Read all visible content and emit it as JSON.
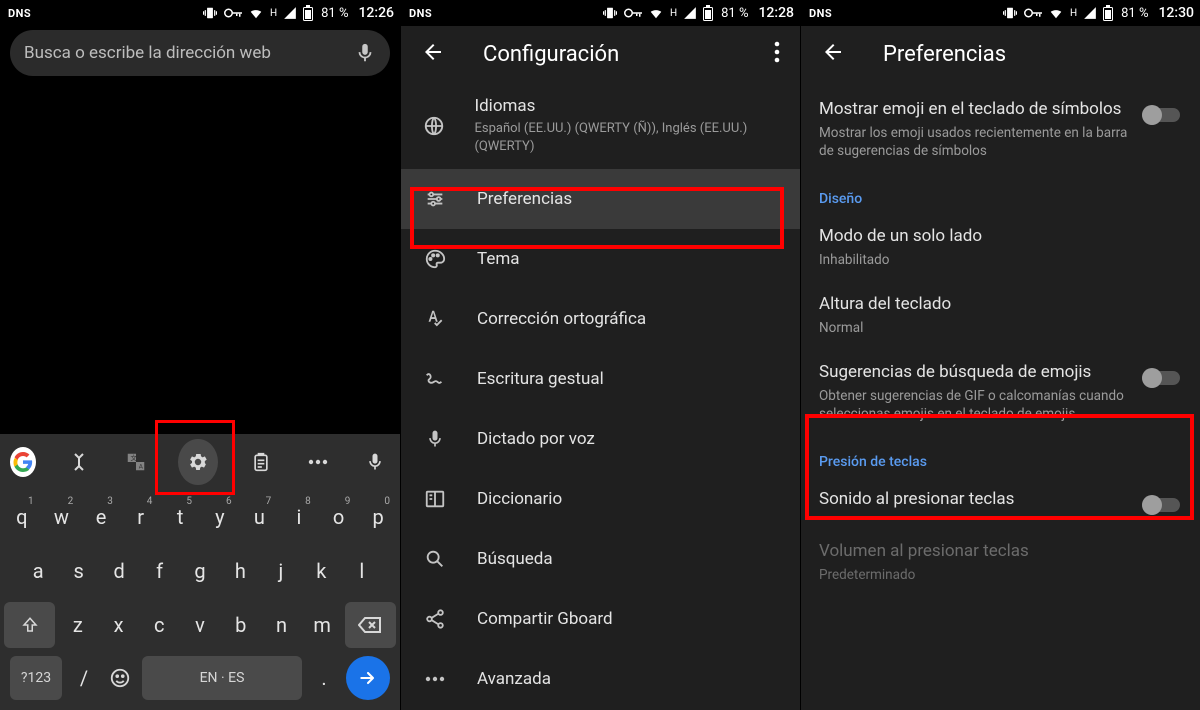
{
  "status": {
    "dns": "DNS",
    "h": "H",
    "batt": "81 %",
    "clocks": [
      "12:26",
      "12:28",
      "12:30"
    ]
  },
  "panel1": {
    "search_placeholder": "Busca o escribe la dirección web",
    "keyboard": {
      "row1": [
        "q",
        "w",
        "e",
        "r",
        "t",
        "y",
        "u",
        "i",
        "o",
        "p"
      ],
      "row1_sup": [
        "1",
        "2",
        "3",
        "4",
        "5",
        "6",
        "7",
        "8",
        "9",
        "0"
      ],
      "row2": [
        "a",
        "s",
        "d",
        "f",
        "g",
        "h",
        "j",
        "k",
        "l"
      ],
      "row3_mid": [
        "z",
        "x",
        "c",
        "v",
        "b",
        "n",
        "m"
      ],
      "sym_key": "?123",
      "slash_key": "/",
      "space_label": "EN · ES",
      "dot_key": "."
    }
  },
  "panel2": {
    "title": "Configuración",
    "items": [
      {
        "icon": "globe",
        "label": "Idiomas",
        "sub": "Español (EE.UU.) (QWERTY (Ñ)), Inglés (EE.UU.) (QWERTY)"
      },
      {
        "icon": "sliders",
        "label": "Preferencias",
        "highlight": true
      },
      {
        "icon": "palette",
        "label": "Tema"
      },
      {
        "icon": "spellcheck",
        "label": "Corrección ortográfica"
      },
      {
        "icon": "gesture",
        "label": "Escritura gestual"
      },
      {
        "icon": "mic",
        "label": "Dictado por voz"
      },
      {
        "icon": "book",
        "label": "Diccionario"
      },
      {
        "icon": "search",
        "label": "Búsqueda"
      },
      {
        "icon": "share",
        "label": "Compartir Gboard"
      },
      {
        "icon": "dots",
        "label": "Avanzada"
      }
    ]
  },
  "panel3": {
    "title": "Preferencias",
    "items": [
      {
        "type": "pref",
        "ttl": "Mostrar emoji en el teclado de símbolos",
        "sub": "Mostrar los emoji usados recientemente en la barra de sugerencias de símbolos",
        "toggle": false
      },
      {
        "type": "head",
        "ttl": "Diseño"
      },
      {
        "type": "pref",
        "ttl": "Modo de un solo lado",
        "sub": "Inhabilitado"
      },
      {
        "type": "pref",
        "ttl": "Altura del teclado",
        "sub": "Normal"
      },
      {
        "type": "pref",
        "ttl": "Sugerencias de búsqueda de emojis",
        "sub": "Obtener sugerencias de GIF o calcomanías cuando seleccionas emojis en el teclado de emojis",
        "toggle": false,
        "highlight": true
      },
      {
        "type": "head",
        "ttl": "Presión de teclas"
      },
      {
        "type": "pref",
        "ttl": "Sonido al presionar teclas",
        "toggle": false
      },
      {
        "type": "pref",
        "ttl": "Volumen al presionar teclas",
        "sub": "Predeterminado",
        "disabled": true
      }
    ]
  }
}
